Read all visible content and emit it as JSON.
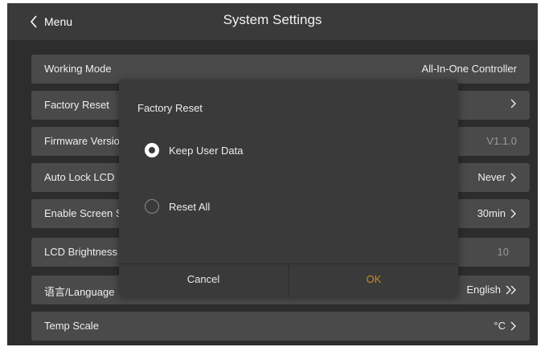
{
  "header": {
    "back_label": "Menu",
    "title": "System Settings"
  },
  "settings": {
    "working_mode": {
      "label": "Working Mode",
      "value": "All-In-One Controller"
    },
    "factory_reset": {
      "label": "Factory Reset",
      "value": ""
    },
    "firmware": {
      "label": "Firmware Version",
      "value": "V1.1.0"
    },
    "auto_lock": {
      "label": "Auto Lock LCD",
      "value": "Never"
    },
    "screen_saver": {
      "label": "Enable Screen Saver",
      "value": "30min"
    },
    "brightness": {
      "label": "LCD Brightness",
      "value": "10"
    },
    "language": {
      "label": "语言/Language",
      "value": "English"
    },
    "temp_scale": {
      "label": "Temp Scale",
      "value": "°C"
    }
  },
  "dialog": {
    "title": "Factory Reset",
    "options": [
      {
        "label": "Keep User Data",
        "selected": true
      },
      {
        "label": "Reset All",
        "selected": false
      }
    ],
    "cancel_label": "Cancel",
    "ok_label": "OK"
  },
  "colors": {
    "background": "#2d2d2d",
    "row": "#4a4a4a",
    "dialog": "#3a3a3a",
    "accent_ok": "#c98a1e"
  },
  "icons": {
    "back": "chevron-left-icon",
    "chevron": "chevron-right-icon",
    "double_chevron": "double-chevron-right-icon"
  }
}
